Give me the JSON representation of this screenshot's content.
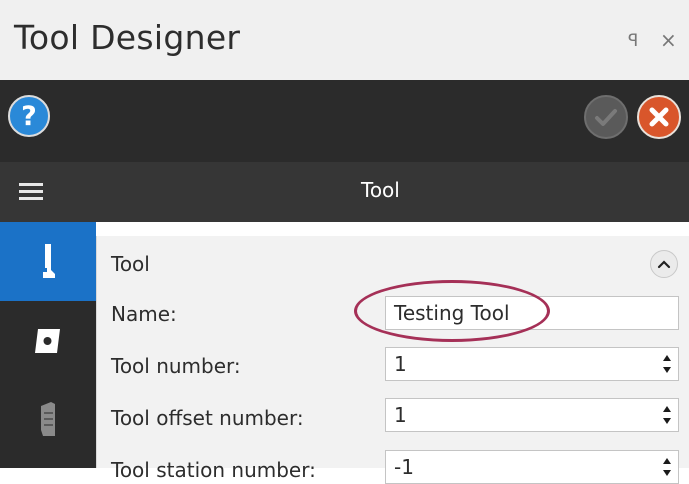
{
  "window": {
    "title": "Tool Designer",
    "pin_glyph": "ꟼ",
    "close_glyph": "×"
  },
  "toolbar": {
    "help_glyph": "?",
    "icons": {
      "help": "help-icon",
      "ok": "checkmark-icon",
      "cancel": "close-icon"
    }
  },
  "header": {
    "title": "Tool",
    "menu_icon": "hamburger-menu-icon"
  },
  "rail": {
    "items": [
      {
        "icon": "tool-holder-icon",
        "active": true
      },
      {
        "icon": "insert-icon",
        "active": false
      },
      {
        "icon": "holder-icon",
        "active": false
      }
    ]
  },
  "section": {
    "title": "Tool",
    "fields": [
      {
        "label": "Name:",
        "value": "Testing Tool",
        "type": "text"
      },
      {
        "label": "Tool number:",
        "value": "1",
        "type": "number"
      },
      {
        "label": "Tool offset number:",
        "value": "1",
        "type": "number"
      },
      {
        "label": "Tool station number:",
        "value": "-1",
        "type": "number"
      }
    ]
  },
  "colors": {
    "accent": "#1b72c7",
    "cancel": "#d9562b",
    "help": "#2a89d8",
    "highlight": "#a53057"
  }
}
